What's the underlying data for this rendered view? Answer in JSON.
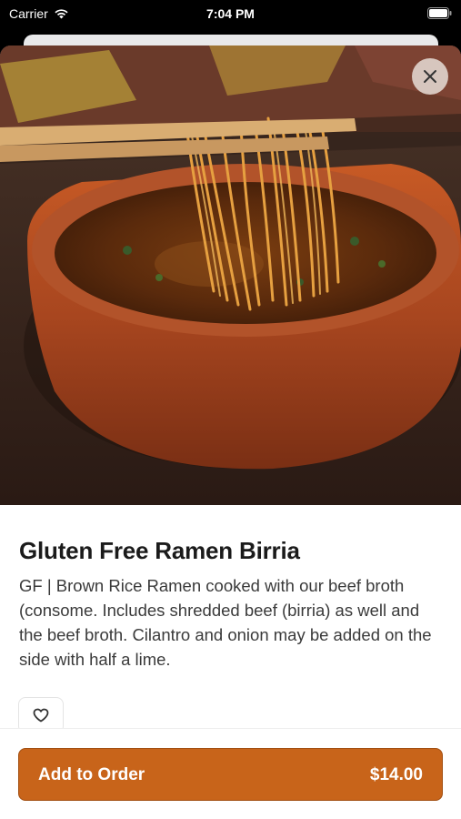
{
  "status_bar": {
    "carrier": "Carrier",
    "time": "7:04 PM",
    "icons": [
      "wifi-icon",
      "battery-icon"
    ]
  },
  "item": {
    "name": "Gluten Free Ramen Birria",
    "description": "GF | Brown Rice Ramen cooked with our beef broth (consome. Includes shredded beef (birria) as well and the beef broth. Cilantro and onion may be added on the side with half a lime.",
    "image_alt": "Ramen noodles lifted with chopsticks from a clay bowl of birria broth"
  },
  "actions": {
    "close_icon": "close-icon",
    "favorite_icon": "heart-icon",
    "add_label": "Add to Order",
    "price": "$14.00"
  },
  "colors": {
    "accent": "#c8641a",
    "accent_border": "#a24f12",
    "title_text": "#1b1b1b",
    "body_text": "#3a3a3a"
  }
}
